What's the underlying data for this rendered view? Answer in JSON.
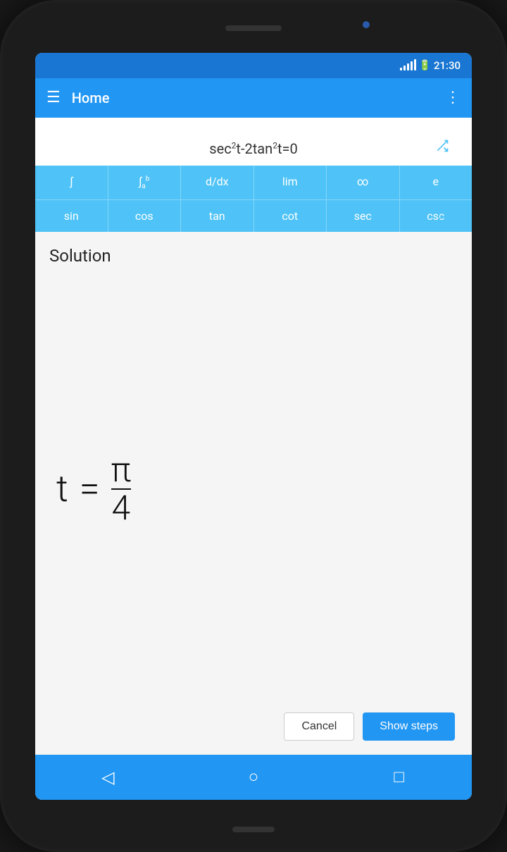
{
  "status_bar": {
    "time": "21:30",
    "signal_bars": [
      4,
      7,
      10,
      13,
      16
    ],
    "battery_level": 80
  },
  "app_bar": {
    "title": "Home",
    "hamburger_label": "☰",
    "more_label": "⋮"
  },
  "equation": {
    "text_parts": [
      "sec",
      "2",
      "t-2tan",
      "2",
      "t=0"
    ],
    "display": "sec²t-2tan²t=0"
  },
  "keyboard": {
    "row1": [
      {
        "label": "∫",
        "id": "integral"
      },
      {
        "label": "∫ᵅb",
        "id": "definite-integral"
      },
      {
        "label": "d/dx",
        "id": "derivative"
      },
      {
        "label": "lim",
        "id": "limit"
      },
      {
        "label": "∞",
        "id": "infinity"
      },
      {
        "label": "e",
        "id": "euler"
      }
    ],
    "row2": [
      {
        "label": "sin",
        "id": "sin"
      },
      {
        "label": "cos",
        "id": "cos"
      },
      {
        "label": "tan",
        "id": "tan"
      },
      {
        "label": "cot",
        "id": "cot"
      },
      {
        "label": "sec",
        "id": "sec"
      },
      {
        "label": "csc",
        "id": "csc"
      }
    ]
  },
  "solution": {
    "title": "Solution",
    "var": "t",
    "equals": "=",
    "numerator": "π",
    "denominator": "4"
  },
  "buttons": {
    "cancel": "Cancel",
    "show_steps": "Show steps"
  },
  "nav_bar": {
    "back": "◁",
    "home": "○",
    "recents": "□"
  },
  "icons": {
    "shuffle": "shuffle-icon",
    "close": "×",
    "star": "☆"
  }
}
